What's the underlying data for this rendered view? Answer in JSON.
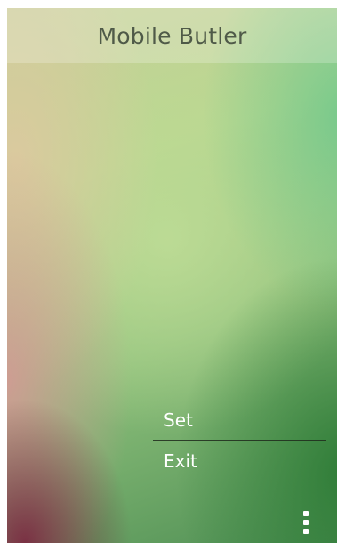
{
  "app": {
    "title": "Mobile Butler"
  },
  "menu": {
    "items": [
      {
        "label": "Set"
      },
      {
        "label": "Exit"
      }
    ]
  },
  "icons": {
    "overflow": "more-vertical-icon"
  },
  "colors": {
    "title_text": "#4f5a48",
    "menu_text": "#ffffff",
    "divider": "#1e2a1c"
  }
}
